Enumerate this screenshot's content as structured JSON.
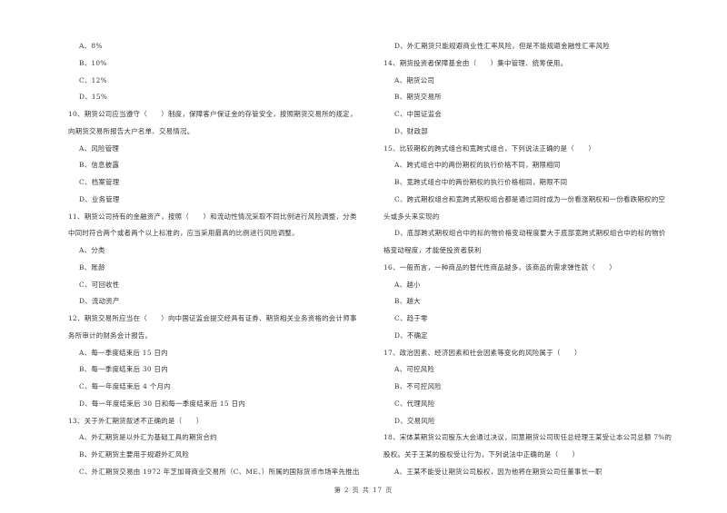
{
  "left_column": [
    {
      "type": "opt",
      "text": "A、8%"
    },
    {
      "type": "opt",
      "text": "B、10%"
    },
    {
      "type": "opt",
      "text": "C、12%"
    },
    {
      "type": "opt",
      "text": "D、15%"
    },
    {
      "type": "q",
      "text": "10、期货公司应当遵守（　　）制度，保障客户保证金的存管安全，按照期货交易所的规定，"
    },
    {
      "type": "cont",
      "text": "向期货交易所报告大户名单、交易情况。"
    },
    {
      "type": "opt",
      "text": "A、风险管理"
    },
    {
      "type": "opt",
      "text": "B、信息披露"
    },
    {
      "type": "opt",
      "text": "C、档案管理"
    },
    {
      "type": "opt",
      "text": "D、业务管理"
    },
    {
      "type": "q",
      "text": "11、期货公司持有的金融资产，按照（　　）和流动性情况采取不同比例进行风险调整，分类"
    },
    {
      "type": "cont",
      "text": "中同时符合两个或者两个以上标准的，应当采用最高的比例进行风险调整。"
    },
    {
      "type": "opt",
      "text": "A、分类"
    },
    {
      "type": "opt",
      "text": "B、账龄"
    },
    {
      "type": "opt",
      "text": "C、可回收性"
    },
    {
      "type": "opt",
      "text": "D、流动资产"
    },
    {
      "type": "q",
      "text": "12、期货交易所应当在（　　）向中国证监会提交经具有证券、期货相关业务资格的会计师事"
    },
    {
      "type": "cont",
      "text": "务所审计的财务会计报告。"
    },
    {
      "type": "opt",
      "text": "A、每一季度结束后 15 日内"
    },
    {
      "type": "opt",
      "text": "B、每一季度结束后 30 日内"
    },
    {
      "type": "opt",
      "text": "C、每一年度结束后 4 个月内"
    },
    {
      "type": "opt",
      "text": "D、每一年度结束后 30 日和每一季度结束后 15 日内"
    },
    {
      "type": "q",
      "text": "13、关于外汇期货叙述不正确的是（　　）"
    },
    {
      "type": "opt",
      "text": "A、外汇期货是以外汇为基础工具的期货合约"
    },
    {
      "type": "opt",
      "text": "B、外汇期货主要用于规避外汇风险"
    },
    {
      "type": "opt",
      "text": "C、外汇期货交易由 1972 年芝加哥商业交易所（C、ME、）所属的国际货币市场率先推出"
    }
  ],
  "right_column": [
    {
      "type": "opt",
      "text": "D、外汇期货只能规避商业性汇率风险，但是不能规避金融性汇率风险"
    },
    {
      "type": "q",
      "text": "14、期货投资者保障基金由（　　）集中管理、统筹使用。"
    },
    {
      "type": "opt",
      "text": "A、期货公司"
    },
    {
      "type": "opt",
      "text": "B、期货交易所"
    },
    {
      "type": "opt",
      "text": "C、中国证监会"
    },
    {
      "type": "opt",
      "text": "D、财政部"
    },
    {
      "type": "q",
      "text": "15、比较期权的跨式组合和宽跨式组合，下列说法正确的是（　　）"
    },
    {
      "type": "opt",
      "text": "A、跨式组合中的两份期权的执行价格不同，期限相同"
    },
    {
      "type": "opt",
      "text": "B、宽跨式组合中的两份期权的执行价格相同，期限不同"
    },
    {
      "type": "opt",
      "text": "C、跨式期权组合和宽跨式期权组合都是通过同时成为一份看涨期权和一份看跌期权的空"
    },
    {
      "type": "cont",
      "text": "头或多头来实现的"
    },
    {
      "type": "opt",
      "text": "D、底部跨式期权组合中的标的物价格变动程度要大于底部宽跨式期权组合中的标的物价"
    },
    {
      "type": "cont",
      "text": "格变动程度，才能使投资者获利"
    },
    {
      "type": "q",
      "text": "16、一般而言，一种商品的替代性商品越多，该商品的需求弹性就（　　）"
    },
    {
      "type": "opt",
      "text": "A、越小"
    },
    {
      "type": "opt",
      "text": "B、越大"
    },
    {
      "type": "opt",
      "text": "C、趋于零"
    },
    {
      "type": "opt",
      "text": "D、不确定"
    },
    {
      "type": "q",
      "text": "17、政治因素、经济因素和社会因素等变化的风险属于（　　）"
    },
    {
      "type": "opt",
      "text": "A、可控风险"
    },
    {
      "type": "opt",
      "text": "B、不可控风险"
    },
    {
      "type": "opt",
      "text": "C、代理风险"
    },
    {
      "type": "opt",
      "text": "D、交易风险"
    },
    {
      "type": "q",
      "text": "18、宋体某期货公司股东大会通过决议，同意期货公司现任总经理王某受让本公司总额 7%的"
    },
    {
      "type": "cont",
      "text": "股权。关于王某的股权受让行为，下列说法中正确的是（　　）"
    },
    {
      "type": "opt",
      "text": "A、王某不能受让期货公司股权，因为他将在期货公司任董事长一职"
    }
  ],
  "footer": {
    "page_label": "第 2 页 共 17 页"
  }
}
